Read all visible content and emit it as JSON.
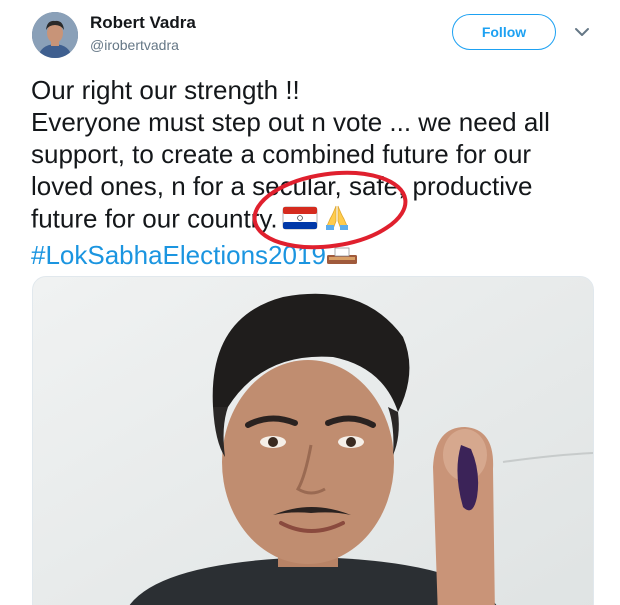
{
  "tweet": {
    "author_name": "Robert Vadra",
    "author_handle": "@irobertvadra",
    "follow_label": "Follow",
    "lines": [
      "Our right our strength !!",
      "Everyone must step out n vote ... we need all",
      "support, to create a combined future for our",
      "loved ones, n for a secular, safe, productive",
      "future for our country."
    ],
    "hashtag": "#LokSabhaElections2019",
    "icons": {
      "more": "chevron-down-icon",
      "flag": "flag-icon",
      "hands": "folded-hands-icon",
      "ballot": "ballot-box-icon"
    },
    "colors": {
      "accent": "#1da1f2",
      "hashtag": "#1b95e0",
      "circle": "#e0202e"
    }
  }
}
